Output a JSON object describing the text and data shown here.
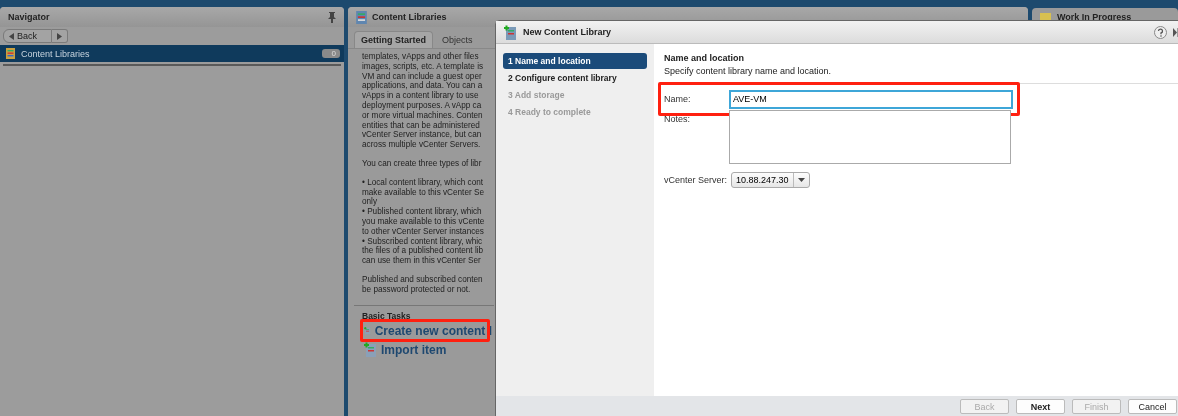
{
  "navigator": {
    "title": "Navigator",
    "back": "Back",
    "items": [
      {
        "label": "Content Libraries",
        "count": "0",
        "selected": true
      }
    ]
  },
  "content_panel": {
    "title": "Content Libraries",
    "tabs": [
      {
        "label": "Getting Started",
        "selected": true
      },
      {
        "label": "Objects",
        "selected": false
      }
    ],
    "paragraphs": [
      [
        "templates, vApps and other files",
        "images, scripts, etc. A template is",
        "VM and can include a guest oper",
        "applications, and data. You can a",
        "vApps in a content library to use",
        "deployment purposes. A vApp ca",
        "or more virtual machines. Conten",
        "entities that can be administered",
        "vCenter Server instance, but can",
        "across multiple vCenter Servers."
      ],
      [
        "You can create three types of libr"
      ],
      [
        "• Local content library, which cont",
        "make available to this vCenter Se",
        "only",
        "• Published content library, which",
        "you make available to this vCente",
        "to other vCenter Server instances",
        "• Subscribed content library, whic",
        "the files of a published content lib",
        "can use them in this vCenter Ser"
      ],
      [
        "Published and subscribed conten",
        "be password protected or not."
      ]
    ],
    "basic_tasks": {
      "title": "Basic Tasks",
      "tasks": [
        {
          "label": "Create new content l",
          "highlighted": true
        },
        {
          "label": "Import item",
          "highlighted": false
        }
      ]
    }
  },
  "side_panel": {
    "title": "Work In Progress"
  },
  "dialog": {
    "title": "New Content Library",
    "steps": [
      {
        "label": "1 Name and location",
        "selected": true,
        "disabled": false
      },
      {
        "label": "2 Configure content library",
        "selected": false,
        "disabled": false
      },
      {
        "label": "3 Add storage",
        "selected": false,
        "disabled": true
      },
      {
        "label": "4 Ready to complete",
        "selected": false,
        "disabled": true
      }
    ],
    "heading": "Name and location",
    "subheading": "Specify content library name and location.",
    "name_label": "Name:",
    "name_value": "AVE-VM",
    "name_highlighted": true,
    "notes_label": "Notes:",
    "server_label": "vCenter Server:",
    "server_value": "10.88.247.30",
    "buttons": [
      {
        "label": "Back",
        "disabled": true,
        "primary": false
      },
      {
        "label": "Next",
        "disabled": false,
        "primary": true
      },
      {
        "label": "Finish",
        "disabled": true,
        "primary": false
      },
      {
        "label": "Cancel",
        "disabled": false,
        "primary": false
      }
    ]
  }
}
